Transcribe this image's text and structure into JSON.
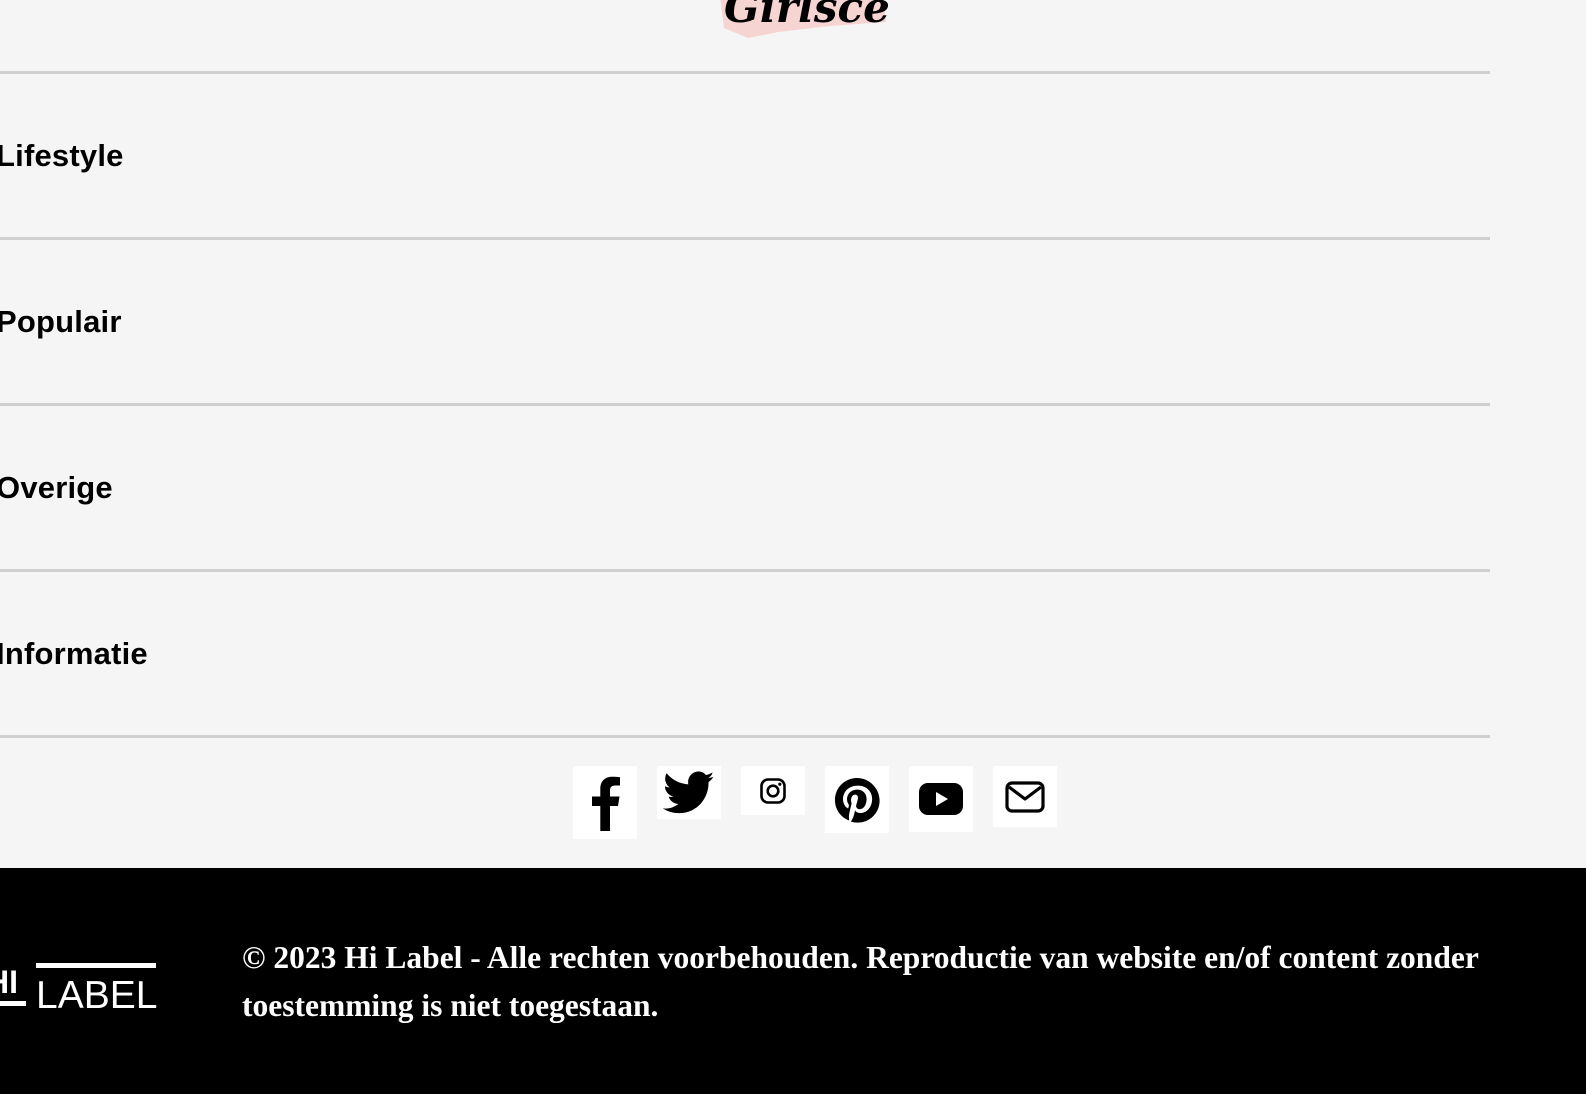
{
  "header": {
    "logo_text": "Girlscene"
  },
  "accordion": {
    "items": [
      {
        "label": "Lifestyle"
      },
      {
        "label": "Populair"
      },
      {
        "label": "Overige"
      },
      {
        "label": "Informatie"
      }
    ]
  },
  "socials": [
    {
      "name": "facebook-icon"
    },
    {
      "name": "twitter-icon"
    },
    {
      "name": "instagram-icon"
    },
    {
      "name": "pinterest-icon"
    },
    {
      "name": "youtube-icon"
    },
    {
      "name": "email-icon"
    }
  ],
  "footer": {
    "logo_text": "HI LABEL",
    "copyright": "© 2023 Hi Label - Alle rechten voorbehouden. Reproductie van website en/of content zonder toestemming is niet toegestaan."
  },
  "colors": {
    "page_background": "#f5f5f5",
    "divider": "#cfcfcf",
    "footer_background": "#000000",
    "logo_accent": "#f6d4d2"
  }
}
